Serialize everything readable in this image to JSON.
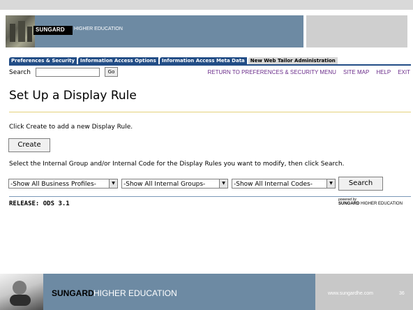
{
  "banner": {
    "brand": "SUNGARD",
    "subtitle": "HIGHER EDUCATION"
  },
  "tabs": [
    {
      "label": "Preferences & Security",
      "active": false
    },
    {
      "label": "Information Access Options",
      "active": false
    },
    {
      "label": "Information Access Meta Data",
      "active": false
    },
    {
      "label": "New Web Tailor Administration",
      "active": true
    }
  ],
  "search": {
    "label": "Search",
    "value": "",
    "go_label": "Go"
  },
  "top_links": [
    "RETURN TO PREFERENCES & SECURITY MENU",
    "SITE MAP",
    "HELP",
    "EXIT"
  ],
  "page": {
    "title": "Set Up a Display Rule",
    "create_instruction": "Click Create to add a new Display Rule.",
    "create_label": "Create",
    "select_instruction": "Select the Internal Group and/or Internal Code for the Display Rules you want to modify, then click Search.",
    "search_label": "Search"
  },
  "filters": {
    "business_profiles": "-Show All Business Profiles-",
    "internal_groups": "-Show All Internal Groups-",
    "internal_codes": "-Show All Internal Codes-"
  },
  "release": {
    "text": "RELEASE: ODS 3.1",
    "powered_by": "powered by",
    "powered_brand": "SUNGARD",
    "powered_suffix": " HIGHER EDUCATION"
  },
  "footer": {
    "brand": "SUNGARD",
    "subtitle": "HIGHER EDUCATION",
    "url": "www.sungardhe.com",
    "page_number": "36"
  },
  "colors": {
    "banner_blue": "#6d8aa3",
    "tab_blue": "#224d86",
    "link_purple": "#6a2c8a"
  }
}
